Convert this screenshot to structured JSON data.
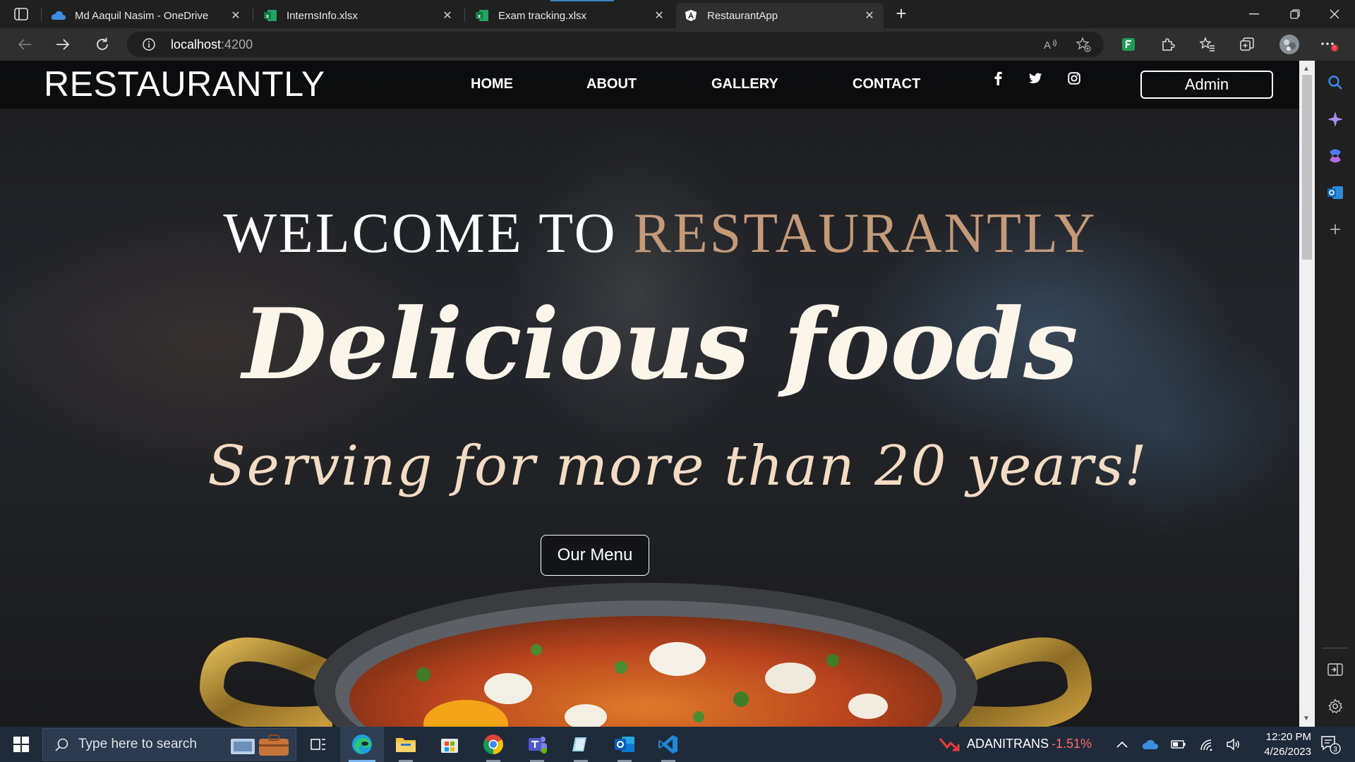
{
  "browser": {
    "tabs": [
      {
        "title": "Md Aaquil Nasim - OneDrive",
        "icon": "onedrive-icon"
      },
      {
        "title": "InternsInfo.xlsx",
        "icon": "excel-icon"
      },
      {
        "title": "Exam tracking.xlsx",
        "icon": "excel-icon"
      },
      {
        "title": "RestaurantApp",
        "icon": "angular-icon",
        "active": true
      }
    ],
    "new_tab": "+",
    "url_host": "localhost",
    "url_port": ":4200"
  },
  "site": {
    "brand": "RESTAURANTLY",
    "nav": [
      "HOME",
      "ABOUT",
      "GALLERY",
      "CONTACT"
    ],
    "social": [
      "facebook-icon",
      "twitter-icon",
      "instagram-icon"
    ],
    "admin_label": "Admin",
    "hero": {
      "welcome": "WELCOME TO",
      "welcome_accent": "RESTAURANTLY",
      "title": "Delicious foods",
      "subtitle": "Serving for more than 20 years!",
      "menu_button": "Our Menu"
    },
    "colors": {
      "accent": "#c49a78",
      "title": "#fbf5ea",
      "subtitle": "#f3dcc4"
    }
  },
  "taskbar": {
    "search_placeholder": "Type here to search",
    "stock_name": "ADANITRANS",
    "stock_change": "-1.51%",
    "time": "12:20 PM",
    "date": "4/26/2023",
    "notifications": "3"
  }
}
